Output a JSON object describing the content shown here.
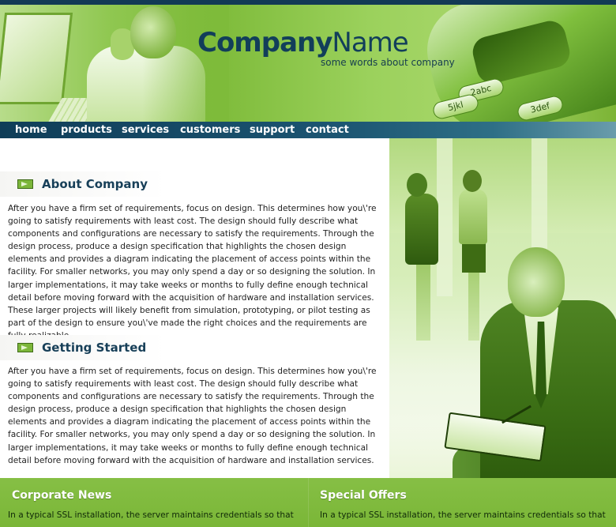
{
  "brand": {
    "name_part1": "Company",
    "name_part2": "Name",
    "tagline": "some words about company"
  },
  "header_keys": [
    "2abc",
    "5jkl",
    "3def"
  ],
  "nav": {
    "items": [
      "home",
      "products",
      "services",
      "customers",
      "support",
      "contact"
    ]
  },
  "sections": [
    {
      "title": "About Company",
      "icon": "arrow-box-icon",
      "text": "After you have a firm set of requirements, focus on design. This determines how you\\'re going to satisfy requirements with least cost. The design should fully describe what components and configurations are necessary to satisfy the requirements. Through the design process, produce a design specification that highlights the chosen design elements and provides a diagram indicating the placement of access points within the facility. For smaller networks, you may only spend a day or so designing the solution. In larger implementations, it may take weeks or months to fully define enough technical detail before moving forward with the acquisition of hardware and installation services. These larger projects will likely benefit from simulation, prototyping, or pilot testing as part of the design to ensure you\\'ve made the right choices and the requirements are fully realizable."
    },
    {
      "title": "Getting Started",
      "icon": "arrow-box-icon",
      "text": "After you have a firm set of requirements, focus on design. This determines how you\\'re going to satisfy requirements with least cost. The design should fully describe what components and configurations are necessary to satisfy the requirements. Through the design process, produce a design specification that highlights the chosen design elements and provides a diagram indicating the placement of access points within the facility. For smaller networks, you may only spend a day or so designing the solution. In larger implementations, it may take weeks or months to fully define enough technical detail before moving forward with the acquisition of hardware and installation services."
    }
  ],
  "footer": {
    "news": {
      "title": "Corporate News",
      "text": "In a typical SSL installation, the server maintains credentials so that"
    },
    "offers": {
      "title": "Special Offers",
      "text": "In a typical SSL installation, the server maintains credentials so that"
    }
  },
  "colors": {
    "accent_green": "#7ebb3a",
    "nav_blue": "#123e5a",
    "title_blue": "#173f58"
  }
}
